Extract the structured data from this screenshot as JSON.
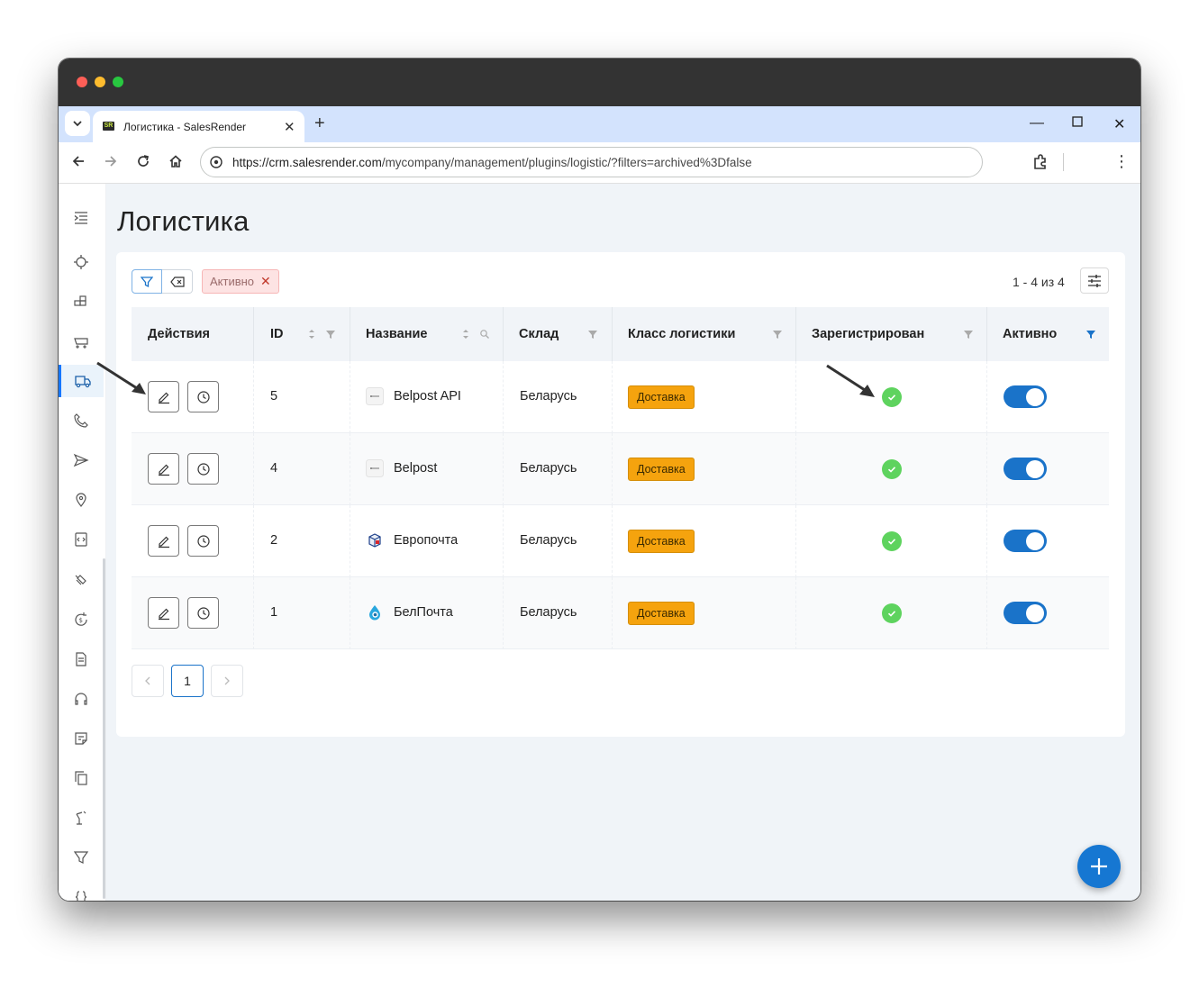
{
  "browser": {
    "tab_title": "Логистика - SalesRender",
    "favicon_text": "SR",
    "url_host": "https://crm.salesrender.com",
    "url_path": "/mycompany/management/plugins/logistic/?filters=archived%3Dfalse"
  },
  "page": {
    "title": "Логистика"
  },
  "filters": {
    "active_chip": "Активно",
    "count": "1 - 4 из 4"
  },
  "table": {
    "columns": [
      "Действия",
      "ID",
      "Название",
      "Склад",
      "Класс логистики",
      "Зарегистрирован",
      "Активно"
    ],
    "rows": [
      {
        "id": "5",
        "name": "Belpost API",
        "warehouse": "Беларусь",
        "class": "Доставка",
        "registered": true,
        "active": true,
        "logo": "belpost-logo"
      },
      {
        "id": "4",
        "name": "Belpost",
        "warehouse": "Беларусь",
        "class": "Доставка",
        "registered": true,
        "active": true,
        "logo": "belpost-logo"
      },
      {
        "id": "2",
        "name": "Европочта",
        "warehouse": "Беларусь",
        "class": "Доставка",
        "registered": true,
        "active": true,
        "logo": "europochta-logo"
      },
      {
        "id": "1",
        "name": "БелПочта",
        "warehouse": "Беларусь",
        "class": "Доставка",
        "registered": true,
        "active": true,
        "logo": "belpochta-logo"
      }
    ]
  },
  "pagination": {
    "current": "1"
  },
  "colors": {
    "accent": "#1677d2",
    "toggle_on": "#1a73c9",
    "badge": "#f5a30e",
    "check": "#5ed35e"
  }
}
